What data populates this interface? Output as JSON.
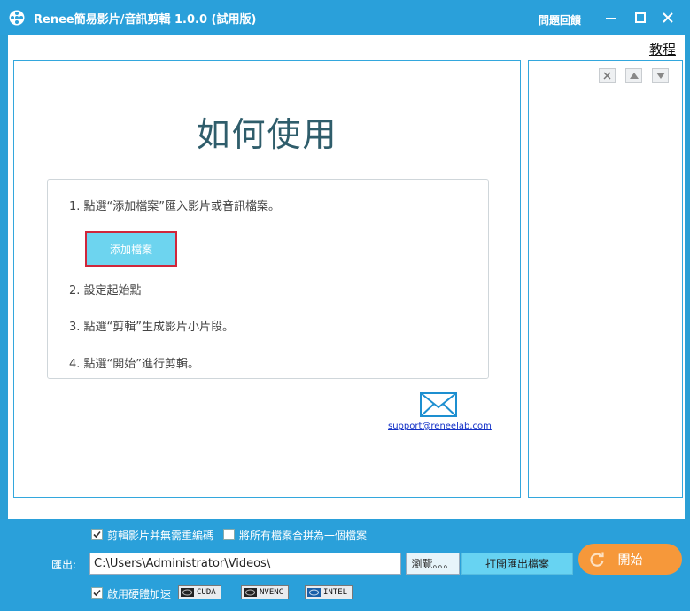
{
  "window": {
    "title": "Renee簡易影片/音訊剪輯 1.0.0 (試用版)",
    "feedback_label": "問題回饋",
    "tutorial_label": "教程"
  },
  "main": {
    "howto_title": "如何使用",
    "steps": [
      "1. 點選“添加檔案”匯入影片或音訊檔案。",
      "2. 設定起始點",
      "3. 點選“剪輯”生成影片小片段。",
      "4. 點選“開始”進行剪輯。"
    ],
    "add_file_label": "添加檔案",
    "support_email": "support@reneelab.com"
  },
  "bottom": {
    "no_reencode_label": "剪輯影片并無需重編碼",
    "no_reencode_checked": true,
    "merge_label": "將所有檔案合拼為一個檔案",
    "merge_checked": false,
    "export_label": "匯出:",
    "export_path": "C:\\Users\\Administrator\\Videos\\",
    "browse_label": "瀏覽。。。",
    "open_folder_label": "打開匯出檔案",
    "start_label": "開始",
    "hw_accel_label": "啟用硬體加速",
    "hw_accel_checked": true,
    "gpu_options": [
      "CUDA",
      "NVENC",
      "INTEL"
    ]
  },
  "colors": {
    "accent": "#2aa0da",
    "start_button": "#f6983a",
    "add_button": "#6dd4ef",
    "add_button_border": "#d0263a"
  }
}
